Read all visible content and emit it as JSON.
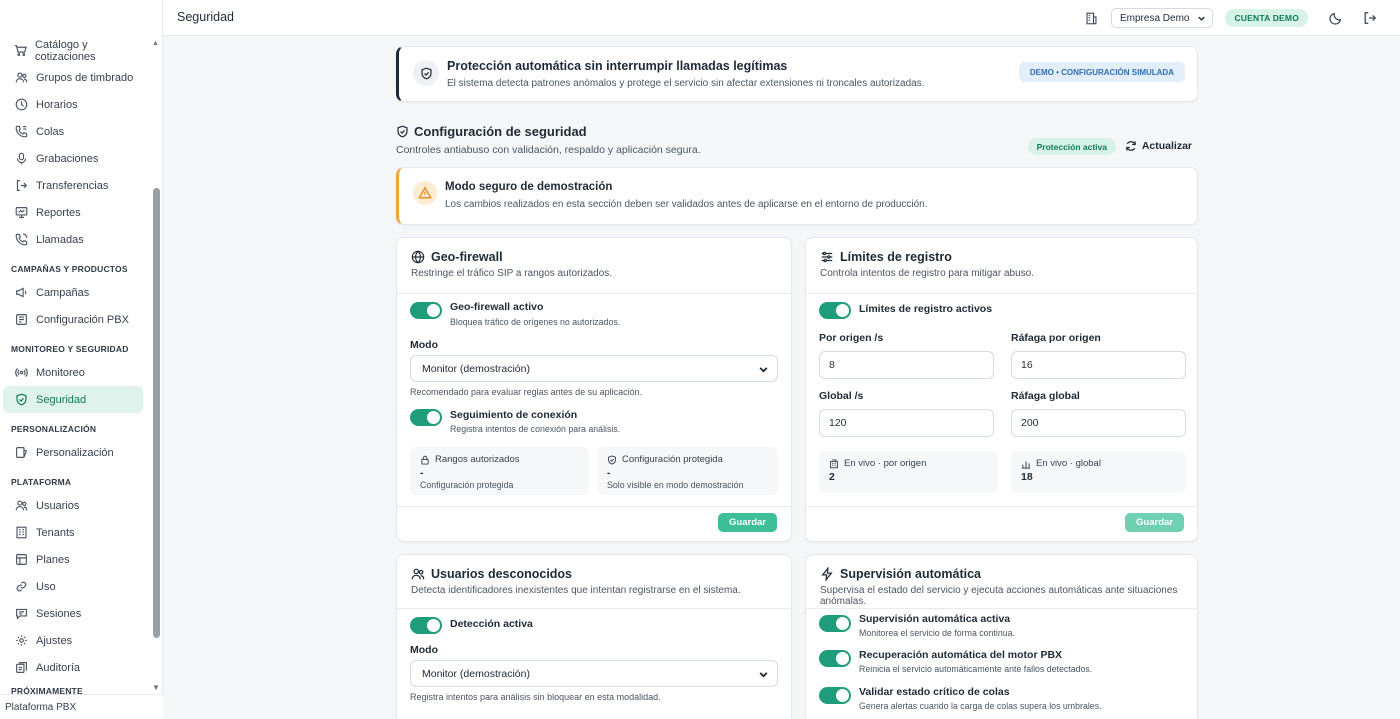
{
  "sidebar": {
    "items_top": [
      {
        "label": "Catálogo y cotizaciones",
        "icon": "cart-icon"
      },
      {
        "label": "Grupos de timbrado",
        "icon": "users-icon"
      },
      {
        "label": "Horarios",
        "icon": "clock-icon"
      },
      {
        "label": "Colas",
        "icon": "phone-queue-icon"
      },
      {
        "label": "Grabaciones",
        "icon": "mic-icon"
      },
      {
        "label": "Transferencias",
        "icon": "transfer-icon"
      },
      {
        "label": "Reportes",
        "icon": "report-icon"
      },
      {
        "label": "Llamadas",
        "icon": "phone-call-icon"
      }
    ],
    "sections": {
      "campaigns": "CAMPAÑAS Y PRODUCTOS",
      "monitoring": "MONITOREO Y SEGURIDAD",
      "personalization": "PERSONALIZACIÓN",
      "platform": "PLATAFORMA",
      "upcoming": "PRÓXIMAMENTE"
    },
    "campaigns_items": [
      "Campañas",
      "Configuración PBX"
    ],
    "monitoring_items": [
      "Monitoreo",
      "Seguridad"
    ],
    "personalization_items": [
      "Personalización"
    ],
    "platform_items": [
      "Usuarios",
      "Tenants",
      "Planes",
      "Uso",
      "Sesiones",
      "Ajustes",
      "Auditoría"
    ],
    "footer": "Plataforma PBX"
  },
  "topbar": {
    "title": "Seguridad",
    "company": "Empresa Demo",
    "demo_badge": "CUENTA DEMO"
  },
  "banner": {
    "title": "Protección automática sin interrumpir llamadas legítimas",
    "subtitle": "El sistema detecta patrones anómalos y protege el servicio sin afectar extensiones ni troncales autorizadas.",
    "pill": "DEMO • CONFIGURACIÓN SIMULADA"
  },
  "section": {
    "title": "Configuración de seguridad",
    "subtitle": "Controles antiabuso con validación, respaldo y aplicación segura.",
    "status": "Protección activa",
    "refresh": "Actualizar"
  },
  "warning": {
    "title": "Modo seguro de demostración",
    "subtitle": "Los cambios realizados en esta sección deben ser validados antes de aplicarse en el entorno de producción."
  },
  "geo": {
    "title": "Geo-firewall",
    "subtitle": "Restringe el tráfico SIP a rangos autorizados.",
    "toggle_label": "Geo-firewall activo",
    "toggle_sub": "Bloquea tráfico de orígenes no autorizados.",
    "mode_label": "Modo",
    "mode_value": "Monitor (demostración)",
    "mode_hint": "Recomendado para evaluar reglas antes de su aplicación.",
    "track_label": "Seguimiento de conexión",
    "track_sub": "Registra intentos de conexión para análisis.",
    "stat1_head": "Rangos autorizados",
    "stat1_value": "-",
    "stat1_foot": "Configuración protegida",
    "stat2_head": "Configuración protegida",
    "stat2_value": "-",
    "stat2_foot": "Solo visible en modo demostración",
    "save": "Guardar"
  },
  "limits": {
    "title": "Límites de registro",
    "subtitle": "Controla intentos de registro para mitigar abuso.",
    "toggle_label": "Límites de registro activos",
    "f1_label": "Por origen /s",
    "f1_value": "8",
    "f2_label": "Ráfaga por origen",
    "f2_value": "16",
    "f3_label": "Global /s",
    "f3_value": "120",
    "f4_label": "Ráfaga global",
    "f4_value": "200",
    "live1_head": "En vivo · por origen",
    "live1_value": "2",
    "live2_head": "En vivo · global",
    "live2_value": "18",
    "save": "Guardar"
  },
  "unknown": {
    "title": "Usuarios desconocidos",
    "subtitle": "Detecta identificadores inexistentes que intentan registrarse en el sistema.",
    "toggle_label": "Detección activa",
    "mode_label": "Modo",
    "mode_value": "Monitor (demostración)",
    "mode_hint": "Registra intentos para análisis sin bloquear en esta modalidad."
  },
  "auto": {
    "title": "Supervisión automática",
    "subtitle": "Supervisa el estado del servicio y ejecuta acciones automáticas ante situaciones anómalas.",
    "t1_label": "Supervisión automática activa",
    "t1_sub": "Monitorea el servicio de forma continua.",
    "t2_label": "Recuperación automática del motor PBX",
    "t2_sub": "Reinicia el servicio automáticamente ante fallos detectados.",
    "t3_label": "Validar estado crítico de colas",
    "t3_sub": "Genera alertas cuando la carga de colas supera los umbrales."
  },
  "colors": {
    "accent": "#1f9d7a",
    "active_bg": "#dff3ec",
    "warning": "#f0a43a"
  }
}
